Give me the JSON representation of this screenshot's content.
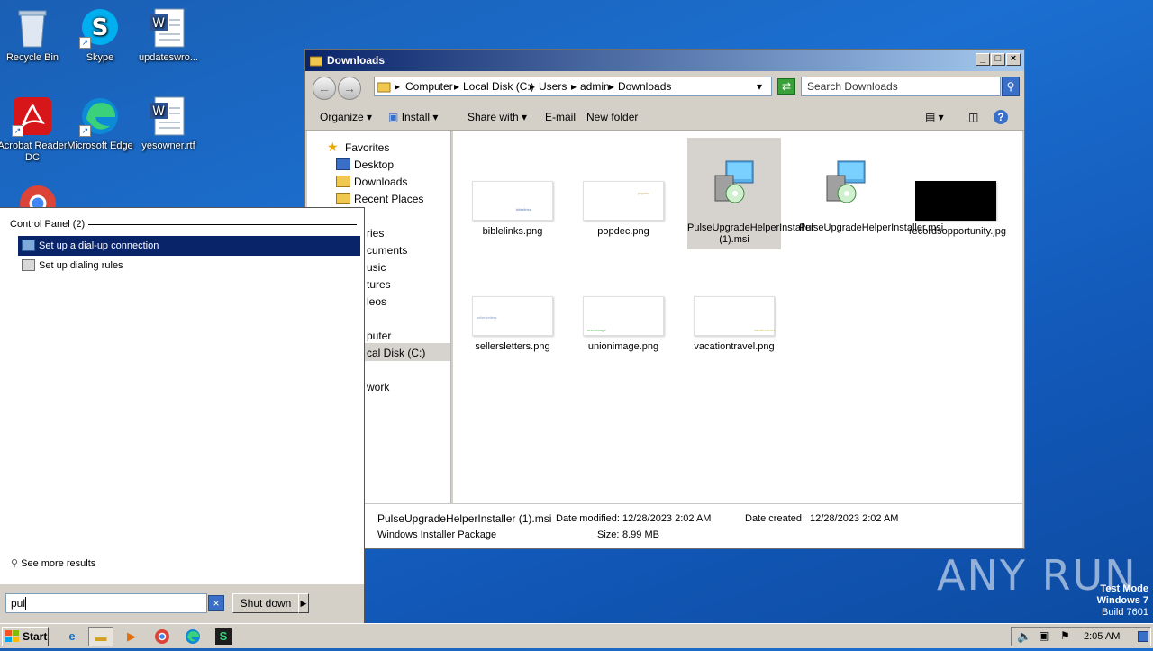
{
  "desktop": {
    "icons": [
      {
        "label": "Recycle Bin"
      },
      {
        "label": "Skype"
      },
      {
        "label": "updateswro..."
      },
      {
        "label": "Acrobat Reader DC"
      },
      {
        "label": "Microsoft Edge"
      },
      {
        "label": "yesowner.rtf"
      }
    ],
    "watermark": "ANY RUN",
    "test_mode": [
      "Test Mode",
      "Windows 7",
      "Build 7601"
    ]
  },
  "explorer": {
    "title": "Downloads",
    "breadcrumb": [
      "Computer",
      "Local Disk (C:)",
      "Users",
      "admin",
      "Downloads"
    ],
    "search_placeholder": "Search Downloads",
    "toolbar": {
      "organize": "Organize",
      "install": "Install",
      "share_with": "Share with",
      "email": "E-mail",
      "new_folder": "New folder"
    },
    "nav": {
      "favorites": "Favorites",
      "items": [
        "Desktop",
        "Downloads",
        "Recent Places"
      ],
      "libraries": "ries",
      "lib_items": [
        "cuments",
        "usic",
        "tures",
        "leos"
      ],
      "computer": "puter",
      "local_disk": "cal Disk (C:)",
      "network": "work"
    },
    "files": [
      {
        "name": "biblelinks.png",
        "preview": "biblelinks"
      },
      {
        "name": "popdec.png",
        "preview": "popdec"
      },
      {
        "name": "PulseUpgradeHelperInstaller (1).msi",
        "preview": ""
      },
      {
        "name": "PulseUpgradeHelperInstaller.msi",
        "preview": ""
      },
      {
        "name": "recordsopportunity.jpg",
        "preview": ""
      },
      {
        "name": "sellersletters.png",
        "preview": "sellersletters"
      },
      {
        "name": "unionimage.png",
        "preview": "unionimage"
      },
      {
        "name": "vacationtravel.png",
        "preview": "vacationtravel"
      }
    ],
    "details": {
      "name": "PulseUpgradeHelperInstaller (1).msi",
      "modified_label": "Date modified:",
      "modified": "12/28/2023 2:02 AM",
      "created_label": "Date created:",
      "created": "12/28/2023 2:02 AM",
      "type": "Windows Installer Package",
      "size_label": "Size:",
      "size": "8.99 MB"
    }
  },
  "startmenu": {
    "group": "Control Panel (2)",
    "results": [
      "Set up a dial-up connection",
      "Set up dialing rules"
    ],
    "see_more": "See more results",
    "search_value": "pul",
    "shutdown": "Shut down"
  },
  "taskbar": {
    "start": "Start",
    "clock": "2:05 AM"
  }
}
